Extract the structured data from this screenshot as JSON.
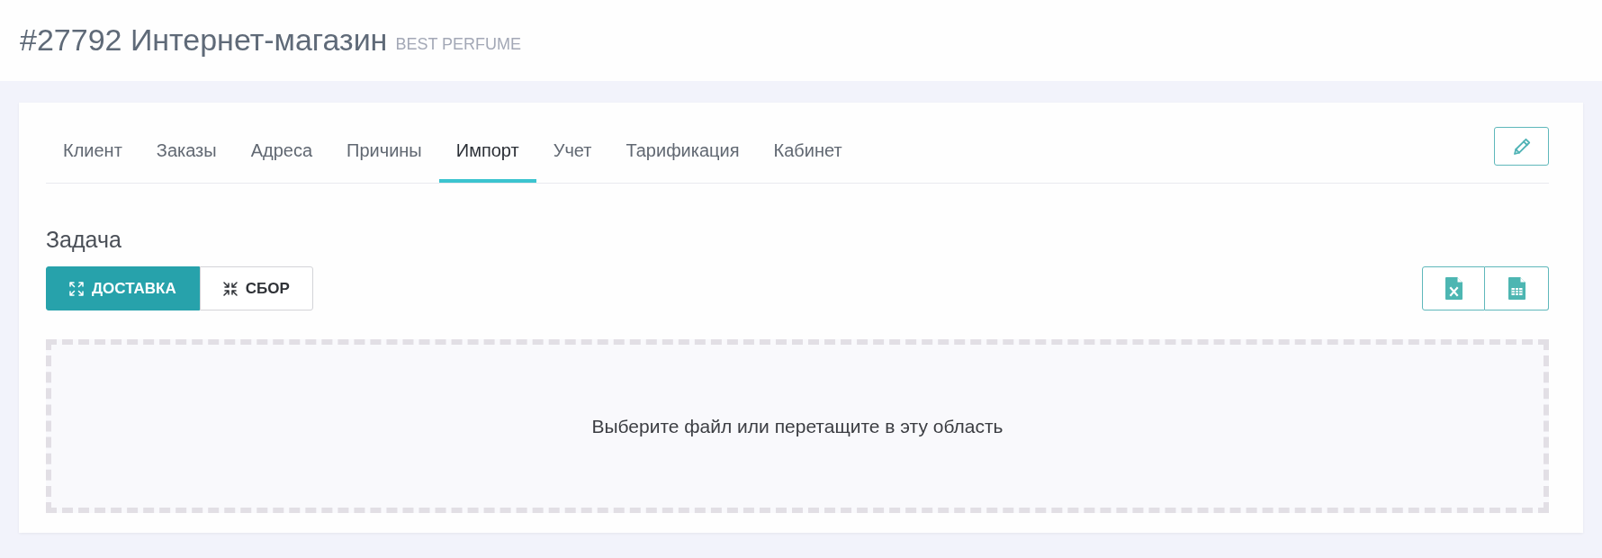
{
  "header": {
    "title": "#27792 Интернет-магазин",
    "subtitle": "BEST PERFUME"
  },
  "tabs": [
    {
      "label": "Клиент",
      "selected": false
    },
    {
      "label": "Заказы",
      "selected": false
    },
    {
      "label": "Адреса",
      "selected": false
    },
    {
      "label": "Причины",
      "selected": false
    },
    {
      "label": "Импорт",
      "selected": true
    },
    {
      "label": "Учет",
      "selected": false
    },
    {
      "label": "Тарификация",
      "selected": false
    },
    {
      "label": "Кабинет",
      "selected": false
    }
  ],
  "task": {
    "label": "Задача",
    "options": [
      {
        "label": "ДОСТАВКА",
        "kind": "expand",
        "selected": true
      },
      {
        "label": "СБОР",
        "kind": "collapse",
        "selected": false
      }
    ]
  },
  "dropzone": {
    "text": "Выберите файл или перетащите в эту область"
  }
}
